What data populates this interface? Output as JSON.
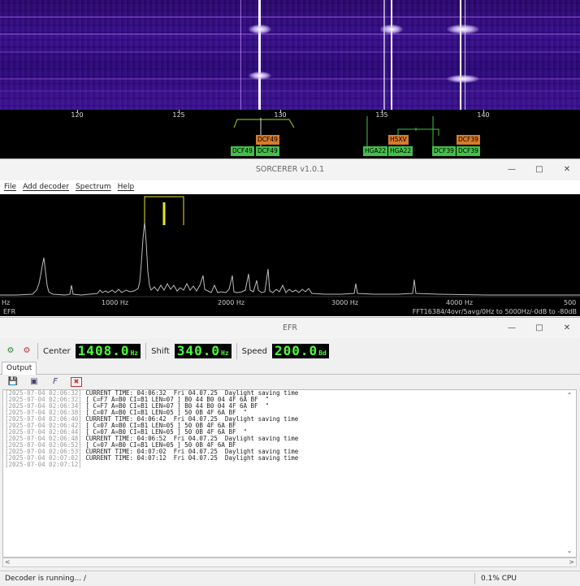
{
  "waterfall": {
    "axis_ticks": [
      "120",
      "125",
      "130",
      "135",
      "140"
    ],
    "signal_tags": [
      {
        "label": "DCF49",
        "color": "green"
      },
      {
        "label": "DCF49",
        "color": "orange"
      },
      {
        "label": "DCF49",
        "color": "green"
      },
      {
        "label": "HGA22",
        "color": "green"
      },
      {
        "label": "H5XV",
        "color": "orange"
      },
      {
        "label": "HGA22",
        "color": "green"
      },
      {
        "label": "DCF39",
        "color": "green"
      },
      {
        "label": "DCF39",
        "color": "orange"
      },
      {
        "label": "DCF39",
        "color": "green"
      }
    ]
  },
  "sorcerer": {
    "title": "SORCERER v1.0.1",
    "menu": {
      "file": "File",
      "add_decoder": "Add decoder",
      "spectrum": "Spectrum",
      "help": "Help"
    },
    "spectrum": {
      "axis_labels": [
        "Hz",
        "1000 Hz",
        "2000 Hz",
        "3000 Hz",
        "4000 Hz",
        "500"
      ],
      "mode_label": "EFR",
      "fft_info": "FFT16384/4ovr/5avg/0Hz to 5000Hz/-0dB to -80dB"
    }
  },
  "efr": {
    "title": "EFR",
    "center_label": "Center",
    "center_value": "1408.0",
    "center_unit": "Hz",
    "shift_label": "Shift",
    "shift_value": "340.0",
    "shift_unit": "Hz",
    "speed_label": "Speed",
    "speed_value": "200.0",
    "speed_unit": "Bd",
    "tab_output": "Output",
    "log": [
      {
        "ts": "[2025-07-04 02:06:32]",
        "msg": "CURRENT TIME: 04:06:32  Fri 04.07.25  Daylight saving time"
      },
      {
        "ts": "[2025-07-04 02:06:32]",
        "msg": "[ C=F7 A=B0 CI=B1 LEN=07 ] B0 44 B0 04 4F 6A BF  \""
      },
      {
        "ts": "[2025-07-04 02:06:34]",
        "msg": "[ C=F7 A=B0 CI=B1 LEN=07 ] B0 44 B0 04 4F 6A BF  \""
      },
      {
        "ts": "[2025-07-04 02:06:38]",
        "msg": "[ C=07 A=B0 CI=B1 LEN=05 ] 50 0B 4F 6A BF  \""
      },
      {
        "ts": "[2025-07-04 02:06:40]",
        "msg": "CURRENT TIME: 04:06:42  Fri 04.07.25  Daylight saving time"
      },
      {
        "ts": "[2025-07-04 02:06:42]",
        "msg": "[ C=07 A=B0 CI=B1 LEN=05 ] 50 0B 4F 6A BF"
      },
      {
        "ts": "[2025-07-04 02:06:44]",
        "msg": "[ C=07 A=B0 CI=B1 LEN=05 ] 50 0B 4F 6A BF  \""
      },
      {
        "ts": "[2025-07-04 02:06:48]",
        "msg": "CURRENT TIME: 04:06:52  Fri 04.07.25  Daylight saving time"
      },
      {
        "ts": "[2025-07-04 02:06:52]",
        "msg": "[ C=07 A=B0 CI=B1 LEN=05 ] 50 0B 4F 6A BF"
      },
      {
        "ts": "[2025-07-04 02:06:53]",
        "msg": "CURRENT TIME: 04:07:02  Fri 04.07.25  Daylight saving time"
      },
      {
        "ts": "[2025-07-04 02:07:02]",
        "msg": "CURRENT TIME: 04:07:12  Fri 04.07.25  Daylight saving time"
      },
      {
        "ts": "[2025-07-04 02:07:12]",
        "msg": ""
      }
    ],
    "status_text": "Decoder is running... /",
    "cpu_text": "0.1% CPU"
  }
}
